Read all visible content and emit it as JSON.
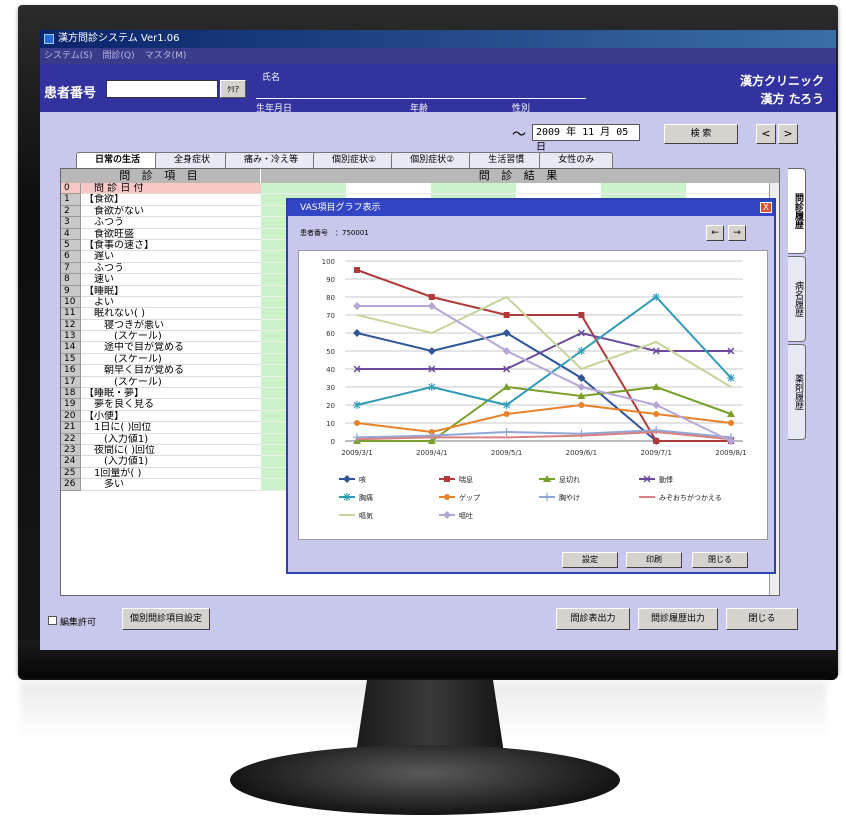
{
  "app": {
    "title": "漢方問診システム Ver1.06",
    "menu": [
      "システム(S)",
      "問診(Q)",
      "マスタ(M)"
    ]
  },
  "header": {
    "patient_label": "患者番号",
    "clear_button": "ｸﾘｱ",
    "name_label": "氏名",
    "birth_label": "生年月日",
    "age_label": "年齢",
    "sex_label": "性別",
    "clinic": "漢方クリニック",
    "doctor": "漢方 たろう"
  },
  "toolbar": {
    "tilde": "～",
    "date": "2009 年 11 月 05 日",
    "search": "検 索",
    "prev": "<",
    "next": ">"
  },
  "tabs": [
    "日常の生活",
    "全身症状",
    "痛み・冷え等",
    "個別症状①",
    "個別症状②",
    "生活習慣",
    "女性のみ"
  ],
  "side_tabs": [
    "問診履歴",
    "病名履歴",
    "薬剤履歴"
  ],
  "grid": {
    "head_item": "問 診 項 目",
    "head_result": "問 診 結 果",
    "rows": [
      {
        "n": "0",
        "label": "　問 診 日 付"
      },
      {
        "n": "1",
        "label": "【食欲】"
      },
      {
        "n": "2",
        "label": "　食欲がない"
      },
      {
        "n": "3",
        "label": "　ふつう"
      },
      {
        "n": "4",
        "label": "　食欲旺盛"
      },
      {
        "n": "5",
        "label": "【食事の速さ】"
      },
      {
        "n": "6",
        "label": "　遅い"
      },
      {
        "n": "7",
        "label": "　ふつう"
      },
      {
        "n": "8",
        "label": "　速い"
      },
      {
        "n": "9",
        "label": "【睡眠】"
      },
      {
        "n": "10",
        "label": "　よい"
      },
      {
        "n": "11",
        "label": "　眠れない( )"
      },
      {
        "n": "12",
        "label": "　　寝つきが悪い"
      },
      {
        "n": "13",
        "label": "　　　(スケール)"
      },
      {
        "n": "14",
        "label": "　　途中で目が覚める"
      },
      {
        "n": "15",
        "label": "　　　(スケール)"
      },
      {
        "n": "16",
        "label": "　　朝早く目が覚める"
      },
      {
        "n": "17",
        "label": "　　　(スケール)"
      },
      {
        "n": "18",
        "label": "【睡眠・夢】"
      },
      {
        "n": "19",
        "label": "　夢を良く見る"
      },
      {
        "n": "20",
        "label": "【小便】"
      },
      {
        "n": "21",
        "label": "　1日に( )回位"
      },
      {
        "n": "22",
        "label": "　　(入力値1)"
      },
      {
        "n": "23",
        "label": "　夜間に( )回位"
      },
      {
        "n": "24",
        "label": "　　(入力値1)"
      },
      {
        "n": "25",
        "label": "　1回量が( )"
      },
      {
        "n": "26",
        "label": "　　多い"
      }
    ]
  },
  "bottom": {
    "checkbox_label": "編集許可",
    "settings": "個別問診項目設定",
    "print_sheet": "問診表出力",
    "print_history": "問診履歴出力",
    "close": "閉じる"
  },
  "dialog": {
    "title": "VAS項目グラフ表示",
    "close_glyph": "X",
    "patient": "患者番号　：750001",
    "prev": "←",
    "next": "→",
    "btn_settings": "設定",
    "btn_print": "印刷",
    "btn_close": "閉じる"
  },
  "chart_data": {
    "type": "line",
    "categories": [
      "2009/3/1",
      "2009/4/1",
      "2009/5/1",
      "2009/6/1",
      "2009/7/1",
      "2009/8/1"
    ],
    "ylim": [
      0,
      100
    ],
    "yticks": [
      0,
      10,
      20,
      30,
      40,
      50,
      60,
      70,
      80,
      90,
      100
    ],
    "legend_position": "bottom",
    "series": [
      {
        "name": "咳",
        "color": "#2f5597",
        "marker": "diamond",
        "values": [
          60,
          50,
          60,
          35,
          0,
          0
        ]
      },
      {
        "name": "喘息",
        "color": "#b03a3a",
        "marker": "square",
        "values": [
          95,
          80,
          70,
          70,
          0,
          0
        ]
      },
      {
        "name": "息切れ",
        "color": "#7aa02c",
        "marker": "triangle",
        "values": [
          0,
          0,
          30,
          25,
          30,
          15
        ]
      },
      {
        "name": "動悸",
        "color": "#6a4a9c",
        "marker": "x",
        "values": [
          40,
          40,
          40,
          60,
          50,
          50
        ]
      },
      {
        "name": "胸痛",
        "color": "#2e9bb5",
        "marker": "star",
        "values": [
          20,
          30,
          20,
          50,
          80,
          35
        ]
      },
      {
        "name": "ゲップ",
        "color": "#e8822a",
        "marker": "circle",
        "values": [
          10,
          5,
          15,
          20,
          15,
          10
        ]
      },
      {
        "name": "胸やけ",
        "color": "#8fa8d8",
        "marker": "plus",
        "values": [
          2,
          3,
          5,
          4,
          6,
          2
        ]
      },
      {
        "name": "みぞおちがつかえる",
        "color": "#d98080",
        "marker": "none",
        "values": [
          1,
          2,
          2,
          3,
          5,
          1
        ]
      },
      {
        "name": "嘔気",
        "color": "#c4d49a",
        "marker": "none",
        "values": [
          70,
          60,
          80,
          40,
          55,
          30
        ]
      },
      {
        "name": "嘔吐",
        "color": "#b6a6d6",
        "marker": "diamond",
        "values": [
          75,
          75,
          50,
          30,
          20,
          0
        ]
      }
    ]
  }
}
